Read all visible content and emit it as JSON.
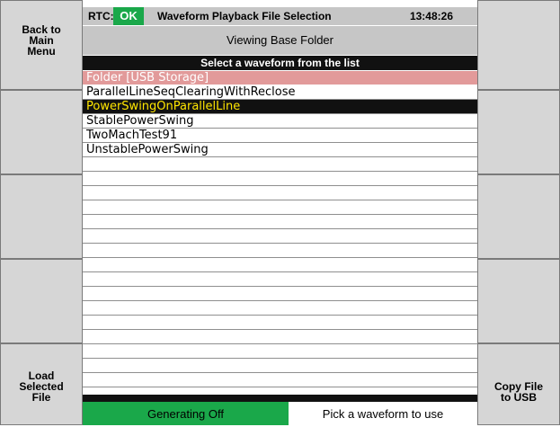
{
  "status": {
    "rtc_label": "RTC:",
    "rtc_value": "OK",
    "title": "Waveform Playback File Selection",
    "time": "13:48:26"
  },
  "subheader": "Viewing Base Folder",
  "list_header": "Select a waveform from the list",
  "files": [
    "Folder [USB Storage]",
    "ParallelLineSeqClearingWithReclose",
    "PowerSwingOnParallelLine",
    "StablePowerSwing",
    "TwoMachTest91",
    "UnstablePowerSwing"
  ],
  "selected_index": 2,
  "left_buttons": [
    "Back to\nMain\nMenu",
    "",
    "",
    "",
    "Load\nSelected\nFile"
  ],
  "right_buttons": [
    "",
    "",
    "",
    "",
    "Copy File\nto USB"
  ],
  "footer": {
    "generating": "Generating Off",
    "hint": "Pick a waveform to use"
  },
  "colors": {
    "ok_green": "#1aa84a",
    "folder_row": "#e29a9a",
    "selected_text": "#ffe600",
    "panel_gray": "#c6c6c6"
  }
}
